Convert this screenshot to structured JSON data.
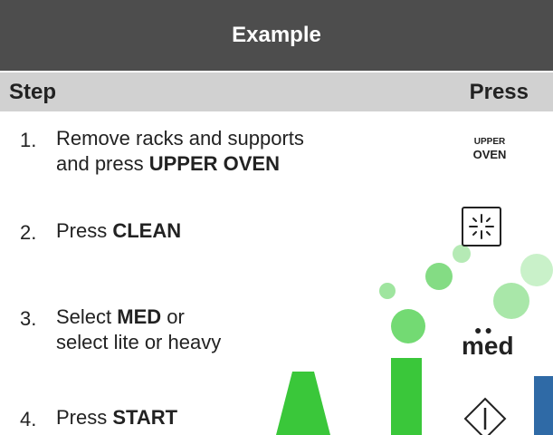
{
  "title": "Example",
  "header": {
    "step": "Step",
    "press": "Press"
  },
  "steps": [
    {
      "num": "1.",
      "line1": "Remove racks and supports",
      "line2_prefix": "and press ",
      "line2_bold": "UPPER OVEN"
    },
    {
      "num": "2.",
      "prefix": "Press ",
      "bold": "CLEAN"
    },
    {
      "num": "3.",
      "prefix": "Select ",
      "bold": "MED",
      "suffix": " or",
      "line2": "select lite or heavy"
    },
    {
      "num": "4.",
      "prefix": "Press ",
      "bold": "START"
    }
  ],
  "buttons": {
    "upper_oven_line1": "UPPER",
    "upper_oven_line2": "OVEN",
    "clean_icon": "sparkle-icon",
    "med_dots": "●●",
    "med_label": "med",
    "start_icon": "start-diamond-icon"
  },
  "colors": {
    "title_bg": "#4d4d4d",
    "header_bg": "#d1d1d1",
    "watermark_green": "#2ecc40",
    "watermark_blue": "#2f6aa6"
  }
}
